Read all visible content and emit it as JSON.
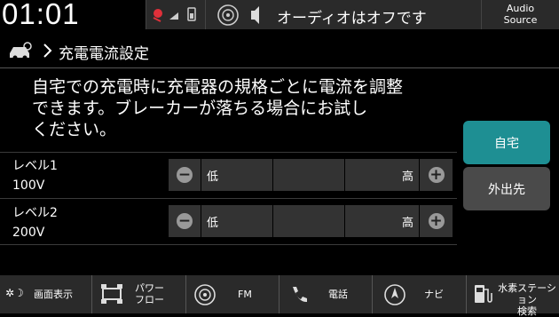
{
  "status": {
    "clock": "01:01",
    "audio_status": "オーディオはオフです",
    "audio_source": "Audio\nSource"
  },
  "breadcrumb": {
    "title": "充電電流設定"
  },
  "description": "自宅での充電時に充電器の規格ごとに電流を調整\nできます。ブレーカーが落ちる場合にお試し\nください。",
  "levels": [
    {
      "label": "レベル1",
      "voltage": "100V",
      "low": "低",
      "high": "高"
    },
    {
      "label": "レベル2",
      "voltage": "200V",
      "low": "低",
      "high": "高"
    }
  ],
  "side_buttons": {
    "home": "自宅",
    "away": "外出先"
  },
  "nav": [
    {
      "label": "画面表示"
    },
    {
      "label": "パワー\nフロー"
    },
    {
      "label": "FM"
    },
    {
      "label": "電話"
    },
    {
      "label": "ナビ"
    },
    {
      "label": "水素ステーション\n検索"
    }
  ],
  "colors": {
    "accent": "#1e8f93",
    "button": "#4a4a4a",
    "panel": "#2a2a2a"
  }
}
